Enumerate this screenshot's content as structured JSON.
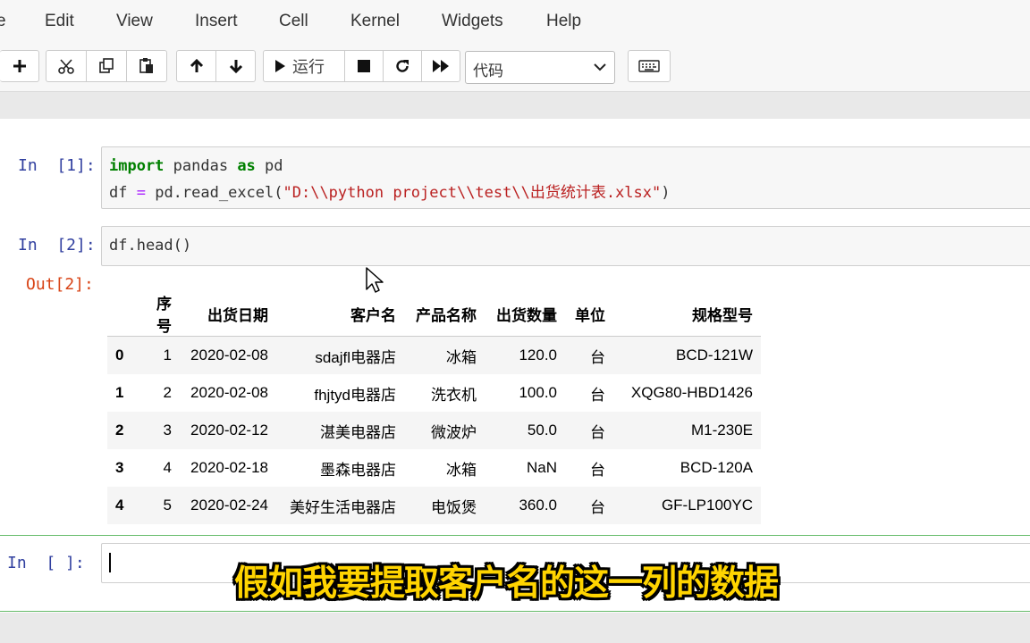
{
  "menu": [
    "e",
    "Edit",
    "View",
    "Insert",
    "Cell",
    "Kernel",
    "Widgets",
    "Help"
  ],
  "toolbar": {
    "run_label": "运行",
    "cell_type": "代码",
    "icons": [
      "plus-icon",
      "cut-icon",
      "copy-icon",
      "paste-icon",
      "arrow-up-icon",
      "arrow-down-icon",
      "run-icon",
      "stop-icon",
      "restart-icon",
      "fast-forward-icon",
      "keyboard-icon"
    ]
  },
  "cells": [
    {
      "prompt": "In  [1]:",
      "code": {
        "l1_kw1": "import",
        "l1_mid": " pandas ",
        "l1_kw2": "as",
        "l1_end": " pd",
        "l2_a": "df ",
        "l2_op": "=",
        "l2_b": " pd.read_excel(",
        "l2_str": "\"D:\\\\python project\\\\test\\\\出货统计表.xlsx\"",
        "l2_c": ")"
      }
    },
    {
      "prompt": "In  [2]:",
      "code": {
        "line": "df.head()"
      }
    }
  ],
  "output": {
    "prompt": "Out[2]:",
    "columns": [
      "",
      "序号",
      "出货日期",
      "客户名",
      "产品名称",
      "出货数量",
      "单位",
      "规格型号"
    ],
    "rows": [
      [
        "0",
        "1",
        "2020-02-08",
        "sdajfl电器店",
        "冰箱",
        "120.0",
        "台",
        "BCD-121W"
      ],
      [
        "1",
        "2",
        "2020-02-08",
        "fhjtyd电器店",
        "洗衣机",
        "100.0",
        "台",
        "XQG80-HBD1426"
      ],
      [
        "2",
        "3",
        "2020-02-12",
        "湛美电器店",
        "微波炉",
        "50.0",
        "台",
        "M1-230E"
      ],
      [
        "3",
        "4",
        "2020-02-18",
        "墨森电器店",
        "冰箱",
        "NaN",
        "台",
        "BCD-120A"
      ],
      [
        "4",
        "5",
        "2020-02-24",
        "美好生活电器店",
        "电饭煲",
        "360.0",
        "台",
        "GF-LP100YC"
      ]
    ]
  },
  "active_cell": {
    "prompt": "In  [ ]:"
  },
  "subtitle": "假如我要提取客户名的这一列的数据"
}
